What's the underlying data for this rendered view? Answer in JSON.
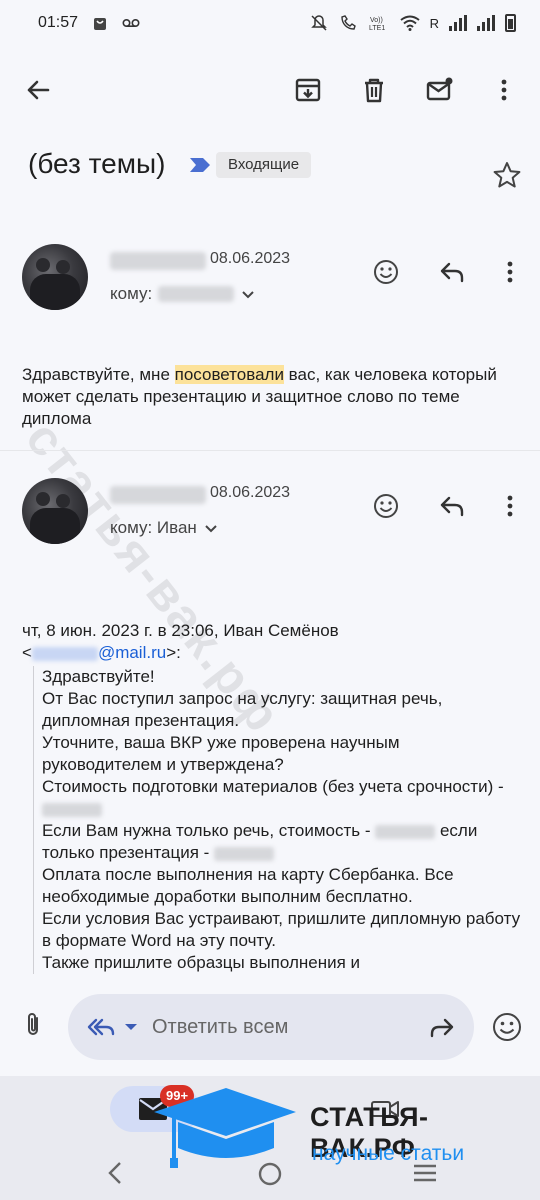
{
  "status_bar": {
    "time": "01:57",
    "carrier_label": "R"
  },
  "subject": {
    "title": "(без темы)",
    "label": "Входящие"
  },
  "messages": [
    {
      "date": "08.06.2023",
      "to_label": "кому:",
      "body_before": "Здравствуйте, мне ",
      "body_highlight": "посоветовали",
      "body_after": " вас, как человека который может сделать презентацию и защитное слово по теме диплома"
    },
    {
      "date": "08.06.2023",
      "to_label": "кому: Иван"
    }
  ],
  "quote": {
    "header_line": "чт, 8 июн. 2023 г. в 23:06, Иван Семёнов",
    "email_prefix": "<",
    "email_domain": "@mail.ru",
    "email_suffix": ">:",
    "lines": [
      "Здравствуйте!",
      "От Вас поступил запрос на услугу: защитная речь, дипломная презентация.",
      "Уточните, ваша ВКР уже проверена научным руководителем и утверждена?",
      "Стоимость подготовки материалов (без учета срочности) -",
      "Если Вам нужна только речь, стоимость -",
      "если",
      "только презентация -",
      "Оплата после выполнения на карту Сбербанка. Все необходимые доработки выполним бесплатно.",
      "Если условия Вас устраивают, пришлите дипломную работу в формате Word на эту почту.",
      "Также пришлите образцы выполнения и"
    ]
  },
  "reply_bar": {
    "placeholder": "Ответить всем"
  },
  "bottom_nav": {
    "mail_badge": "99+"
  },
  "watermark": {
    "text": "статья-вак.рф"
  },
  "logo": {
    "title": "СТАТЬЯ-ВАК.РФ",
    "subtitle": "научные статьи"
  },
  "colors": {
    "accent": "#1a5fd6",
    "highlight": "#fce29a",
    "badge": "#d93025",
    "logo_blue": "#1f8ff0"
  }
}
